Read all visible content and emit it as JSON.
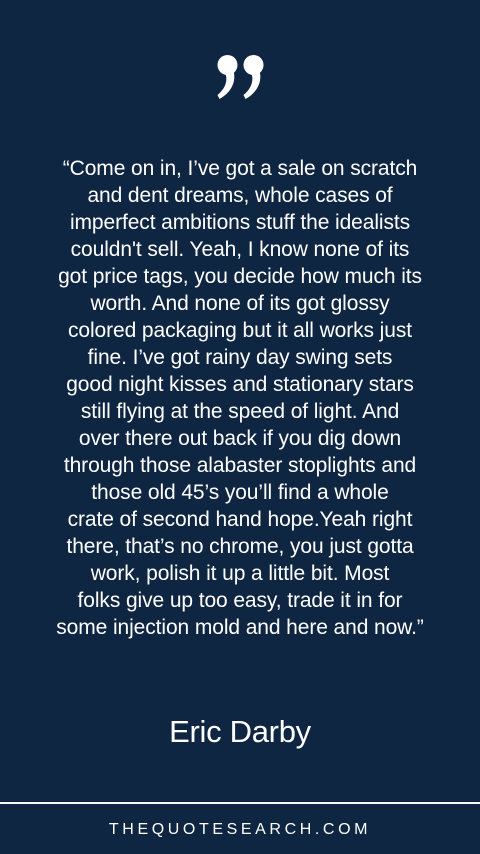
{
  "quote": {
    "text": "“Come on in, I’ve got a sale on scratch\nand dent dreams, whole cases of\nimperfect ambitions stuff the idealists\ncouldn't sell. Yeah, I know none of its\ngot price tags, you decide how much its\nworth. And none of its got glossy\ncolored packaging but it all works just\nfine. I’ve got rainy day swing sets\ngood night kisses and stationary stars\nstill flying at the speed of light. And\nover there out back if you dig down\nthrough those alabaster stoplights and\nthose old 45’s you’ll find a whole\ncrate of second hand hope.Yeah right\nthere, that’s no chrome, you just gotta\nwork, polish it up a little bit. Most\nfolks give up too easy, trade it in for\nsome injection mold and here and now.”",
    "author": "Eric Darby"
  },
  "footer": {
    "site": "THEQUOTESEARCH.COM"
  },
  "colors": {
    "background": "#0f2642",
    "text": "#ffffff"
  },
  "icons": {
    "quote_mark": "closing-double-quote-icon"
  }
}
